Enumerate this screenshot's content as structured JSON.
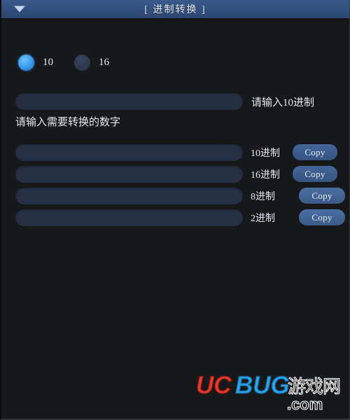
{
  "window": {
    "title": "[ 进制转换 ]",
    "menu_icon": "chevron-down-icon"
  },
  "colors": {
    "titlebar_top": "#3a5a8c",
    "titlebar_bottom": "#2c4771",
    "body_bg": "#16181a",
    "field_bg": "#252f42",
    "button_bg": "#3b5c8d",
    "radio_selected": "#3d9dee",
    "text": "#e4e8ee",
    "watermark_uc": "#e8392d",
    "watermark_bug": "#2aa3e8"
  },
  "base_selector": {
    "options": [
      {
        "label": "10",
        "selected": true
      },
      {
        "label": "16",
        "selected": false
      }
    ]
  },
  "input_section": {
    "value": "",
    "placeholder": "",
    "side_label": "请输入10进制",
    "hint": "请输入需要转换的数字"
  },
  "results": {
    "copy_label": "Copy",
    "rows": [
      {
        "value": "",
        "label": "10进制",
        "copy": "Copy"
      },
      {
        "value": "",
        "label": "16进制",
        "copy": "Copy"
      },
      {
        "value": "",
        "label": "8进制",
        "copy": "Copy"
      },
      {
        "value": "",
        "label": "2进制",
        "copy": "Copy"
      }
    ]
  },
  "watermark": {
    "part_uc": "UC",
    "part_bug": "BUG",
    "part_cn": "游戏网",
    "part_com": ".com"
  }
}
